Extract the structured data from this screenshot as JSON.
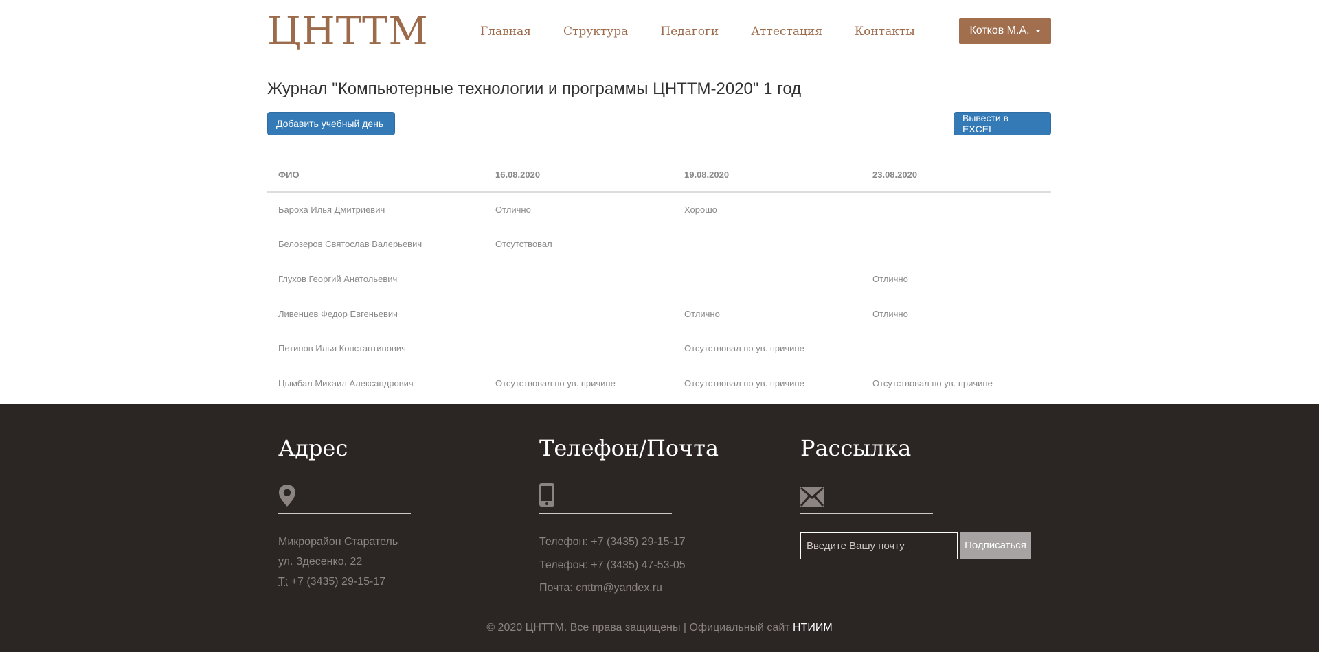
{
  "header": {
    "logo": "ЦНТТМ",
    "nav": [
      "Главная",
      "Структура",
      "Педагоги",
      "Аттестация",
      "Контакты"
    ],
    "user": "Котков М.А."
  },
  "main": {
    "title": "Журнал \"Компьютерные технологии и программы ЦНТТМ-2020\" 1 год",
    "add_day_label": "Добавить учебный день",
    "excel_label": "Вывести в EXCEL",
    "table": {
      "headers": [
        "ФИО",
        "16.08.2020",
        "19.08.2020",
        "23.08.2020"
      ],
      "rows": [
        [
          "Бароха Илья Дмитриевич",
          "Отлично",
          "Хорошо",
          ""
        ],
        [
          "Белозеров Святослав Валерьевич",
          "Отсутствовал",
          "",
          ""
        ],
        [
          "Глухов Георгий Анатольевич",
          "",
          "",
          "Отлично"
        ],
        [
          "Ливенцев Федор Евгеньевич",
          "",
          "Отлично",
          "Отлично"
        ],
        [
          "Петинов Илья Константинович",
          "",
          "Отсутствовал по ув. причине",
          ""
        ],
        [
          "Цымбал Михаил Александрович",
          "Отсутствовал по ув. причине",
          "Отсутствовал по ув. причине",
          "Отсутствовал по ув. причине"
        ]
      ]
    }
  },
  "footer": {
    "address": {
      "title": "Адрес",
      "icon": "map-marker-icon",
      "line1": "Микрорайон Старатель",
      "line2": "ул. Здесенко, 22",
      "phone_label": "Т:",
      "phone": " +7 (3435) 29-15-17"
    },
    "contacts": {
      "title": "Телефон/Почта",
      "icon": "mobile-phone-icon",
      "phone1": "Телефон: +7 (3435) 29-15-17",
      "phone2": "Телефон: +7 (3435) 47-53-05",
      "email": "Почта: cnttm@yandex.ru"
    },
    "subscribe": {
      "title": "Рассылка",
      "icon": "envelope-icon",
      "placeholder": "Введите Вашу почту",
      "button": "Подписаться"
    },
    "copyright": "© 2020 ЦНТТМ. Все права защищены | Официальный сайт ",
    "copyright_link": "НТИИМ"
  },
  "colors": {
    "brand": "#9c6b4b",
    "primary_button": "#337ab7",
    "footer_bg": "#2b2524"
  }
}
